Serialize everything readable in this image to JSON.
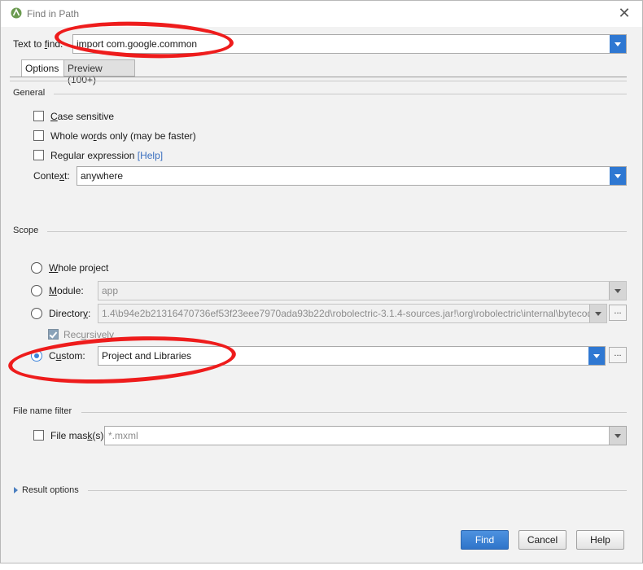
{
  "window": {
    "title": "Find in Path",
    "app_icon": "android-studio-icon",
    "close_icon": "close-icon"
  },
  "search": {
    "label_pre": "Text to ",
    "label_u": "f",
    "label_post": "ind:",
    "value": "import com.google.common"
  },
  "tabs": [
    {
      "label": "Options",
      "active": true
    },
    {
      "label": "Preview (100+)",
      "active": false
    }
  ],
  "general": {
    "title": "General",
    "case_sensitive": {
      "u": "C",
      "rest": "ase sensitive",
      "checked": false
    },
    "whole_words": {
      "pre": "Whole wo",
      "u": "r",
      "rest": "ds only (may be faster)",
      "checked": false
    },
    "regex": {
      "pre": "Re",
      "u": "g",
      "rest": "ular expression",
      "help": "[Help]",
      "checked": false
    },
    "context": {
      "pre": "Conte",
      "u": "x",
      "rest": "t:",
      "value": "anywhere"
    }
  },
  "scope": {
    "title": "Scope",
    "whole_project": {
      "pre": "",
      "u": "W",
      "rest": "hole project",
      "selected": false
    },
    "module": {
      "pre": "",
      "u": "M",
      "rest": "odule:",
      "value": "app",
      "selected": false
    },
    "directory": {
      "pre": "Director",
      "u": "y",
      "rest": ":",
      "value": "1.4\\b94e2b21316470736ef53f23eee7970ada93b22d\\robolectric-3.1.4-sources.jar!\\org\\robolectric\\internal\\bytecode",
      "selected": false
    },
    "recursively": {
      "pre": "Rec",
      "u": "u",
      "rest": "rsively",
      "checked": true
    },
    "custom": {
      "pre": "C",
      "u": "u",
      "rest": "stom:",
      "value": "Project and Libraries",
      "selected": true
    },
    "ellipsis": "..."
  },
  "file_filter": {
    "title": "File name filter",
    "mask": {
      "pre": "File mas",
      "u": "k",
      "rest": "(s)",
      "placeholder": "*.mxml",
      "checked": false
    }
  },
  "result_options": {
    "label": "Result options"
  },
  "buttons": {
    "find": "Find",
    "cancel": "Cancel",
    "help": "Help"
  },
  "colors": {
    "accent": "#2f78d2",
    "annotation": "#ee1c1c"
  }
}
